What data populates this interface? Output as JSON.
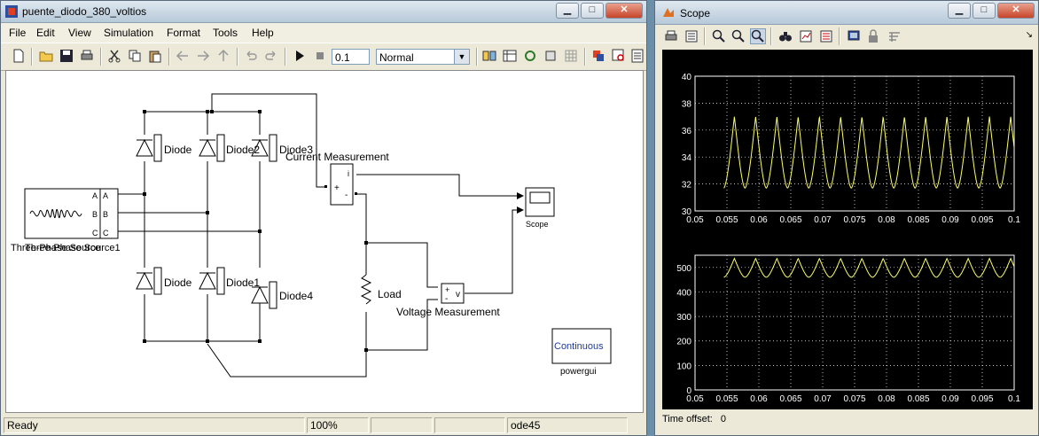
{
  "simulink": {
    "title": "puente_diodo_380_voltios",
    "menu": [
      "File",
      "Edit",
      "View",
      "Simulation",
      "Format",
      "Tools",
      "Help"
    ],
    "stop_time": "0.1",
    "sim_mode": "Normal",
    "status": {
      "ready": "Ready",
      "zoom": "100%",
      "solver": "ode45"
    },
    "blocks": {
      "source_label": "Three-Phase Source",
      "source_label_overlap": "Three-Phase Source1",
      "ports": [
        "A",
        "B",
        "C"
      ],
      "diodes": [
        "Diode",
        "Diode2",
        "Diode3",
        "Diode",
        "Diode1",
        "Diode4"
      ],
      "current_measurement": "Current Measurement",
      "voltage_measurement": "Voltage Measurement",
      "load": "Load",
      "scope": "Scope",
      "powergui_box": "Continuous",
      "powergui": "powergui",
      "cm_port_i": "i",
      "cm_port_plus": "+",
      "cm_port_minus": "-",
      "vm_port_plus": "+",
      "vm_port_minus": "-",
      "vm_port_v": "v"
    }
  },
  "scope": {
    "title": "Scope",
    "time_offset_label": "Time offset:",
    "time_offset_value": "0",
    "colors": {
      "background": "#000000",
      "trace": "#ffff66",
      "axes": "#ffffff"
    }
  },
  "chart_data": [
    {
      "type": "line",
      "title": "",
      "xlabel": "",
      "ylabel": "",
      "xlim": [
        0.05,
        0.1
      ],
      "ylim": [
        30,
        40
      ],
      "xticks": [
        "0.05",
        "0.055",
        "0.06",
        "0.065",
        "0.07",
        "0.075",
        "0.08",
        "0.085",
        "0.09",
        "0.095",
        "0.1"
      ],
      "yticks": [
        "30",
        "32",
        "34",
        "36",
        "38",
        "40"
      ],
      "grid": true,
      "series": [
        {
          "pattern": "rectified-ripple",
          "start_x": 0.0545,
          "period": 0.00333,
          "peak": 37.0,
          "trough": 31.7
        }
      ]
    },
    {
      "type": "line",
      "title": "",
      "xlabel": "",
      "ylabel": "",
      "xlim": [
        0.05,
        0.1
      ],
      "ylim": [
        0,
        550
      ],
      "xticks": [
        "0.05",
        "0.055",
        "0.06",
        "0.065",
        "0.07",
        "0.075",
        "0.08",
        "0.085",
        "0.09",
        "0.095",
        "0.1"
      ],
      "yticks": [
        "0",
        "100",
        "200",
        "300",
        "400",
        "500"
      ],
      "grid": true,
      "series": [
        {
          "pattern": "rectified-ripple",
          "start_x": 0.0545,
          "period": 0.00333,
          "peak": 537,
          "trough": 460
        }
      ]
    }
  ]
}
